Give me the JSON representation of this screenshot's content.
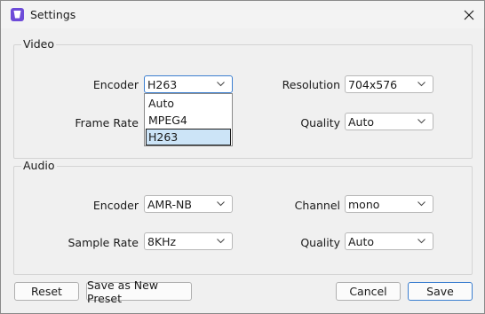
{
  "window": {
    "title": "Settings",
    "app_icon": "app-logo-icon",
    "close_icon": "close-icon"
  },
  "video": {
    "group_title": "Video",
    "encoder_label": "Encoder",
    "encoder_value": "H263",
    "encoder_options": [
      "Auto",
      "MPEG4",
      "H263"
    ],
    "frame_rate_label": "Frame Rate",
    "resolution_label": "Resolution",
    "resolution_value": "704x576",
    "quality_label": "Quality",
    "quality_value": "Auto"
  },
  "audio": {
    "group_title": "Audio",
    "encoder_label": "Encoder",
    "encoder_value": "AMR-NB",
    "sample_rate_label": "Sample Rate",
    "sample_rate_value": "8KHz",
    "channel_label": "Channel",
    "channel_value": "mono",
    "quality_label": "Quality",
    "quality_value": "Auto"
  },
  "buttons": {
    "reset": "Reset",
    "save_preset": "Save as New Preset",
    "cancel": "Cancel",
    "save": "Save"
  }
}
